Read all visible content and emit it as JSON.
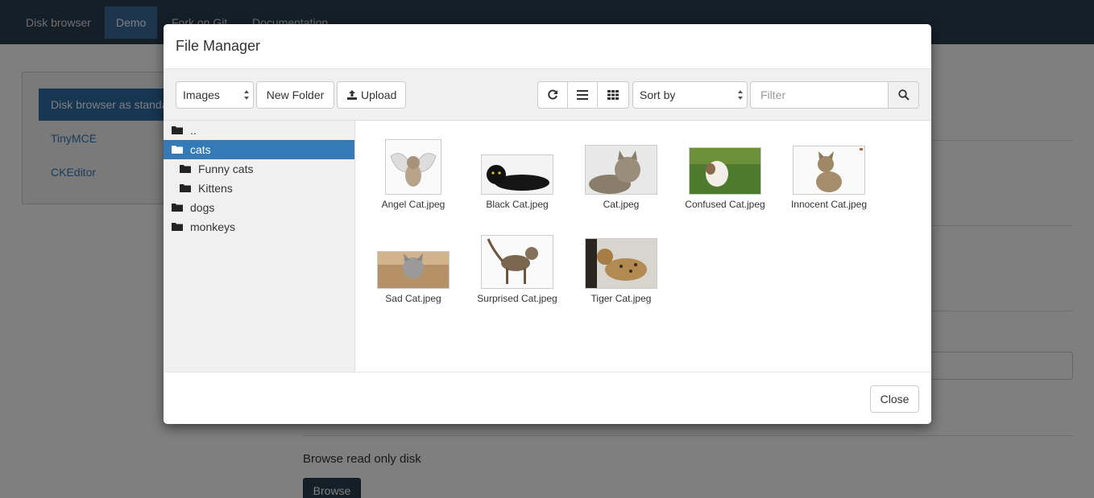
{
  "navbar": {
    "items": [
      "Disk browser",
      "Demo",
      "Fork on Git",
      "Documentation"
    ]
  },
  "sidebar": {
    "items": [
      "Disk browser as standalone",
      "TinyMCE",
      "CKEditor"
    ]
  },
  "background": {
    "section_label": "Browse read only disk",
    "browse_button": "Browse"
  },
  "modal": {
    "title": "File Manager",
    "toolbar": {
      "type_select": "Images",
      "new_folder": "New Folder",
      "upload": "Upload",
      "sort_select": "Sort by",
      "filter_placeholder": "Filter"
    },
    "tree": [
      {
        "label": "..",
        "level": 0
      },
      {
        "label": "cats",
        "level": 0,
        "selected": true
      },
      {
        "label": "Funny cats",
        "level": 1
      },
      {
        "label": "Kittens",
        "level": 1
      },
      {
        "label": "dogs",
        "level": 0
      },
      {
        "label": "monkeys",
        "level": 0
      }
    ],
    "files": [
      "Angel Cat.jpeg",
      "Black Cat.jpeg",
      "Cat.jpeg",
      "Confused Cat.jpeg",
      "Innocent Cat.jpeg",
      "Sad Cat.jpeg",
      "Surprised Cat.jpeg",
      "Tiger Cat.jpeg"
    ],
    "close_label": "Close"
  },
  "colors": {
    "navbar": "#2b3e50",
    "selected": "#337ab7"
  }
}
